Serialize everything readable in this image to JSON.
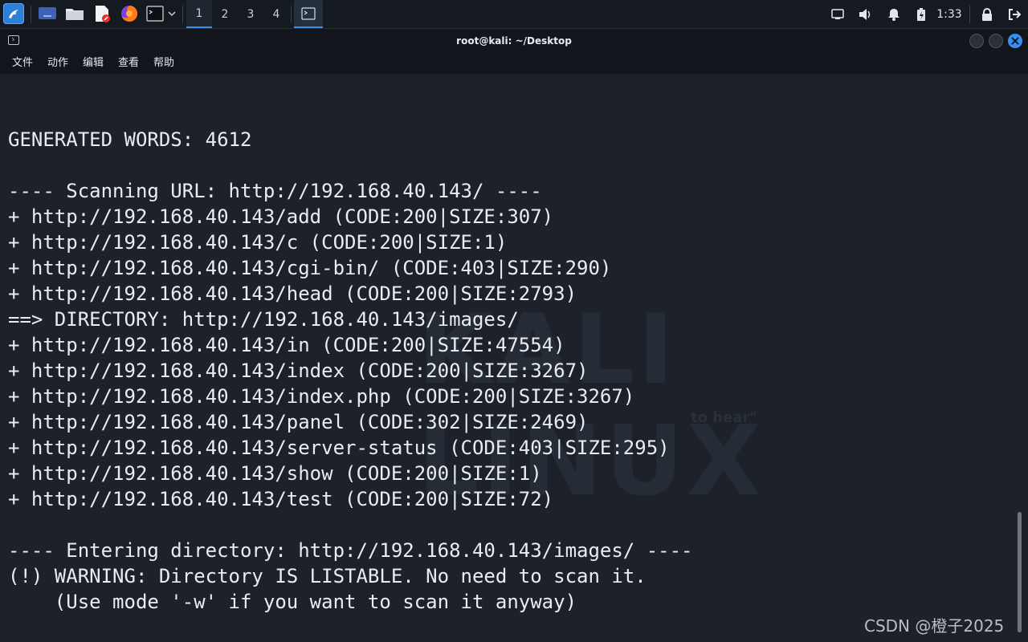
{
  "taskbar": {
    "workspaces": [
      "1",
      "2",
      "3",
      "4"
    ],
    "clock": "1:33",
    "launchers": [
      "show-desktop",
      "file-manager",
      "text-editor",
      "firefox",
      "terminal"
    ]
  },
  "window": {
    "title": "root@kali: ~/Desktop",
    "menu": [
      "文件",
      "动作",
      "编辑",
      "查看",
      "帮助"
    ]
  },
  "terminal": {
    "lines": [
      "",
      "GENERATED WORDS: 4612",
      "",
      "---- Scanning URL: http://192.168.40.143/ ----",
      "+ http://192.168.40.143/add (CODE:200|SIZE:307)",
      "+ http://192.168.40.143/c (CODE:200|SIZE:1)",
      "+ http://192.168.40.143/cgi-bin/ (CODE:403|SIZE:290)",
      "+ http://192.168.40.143/head (CODE:200|SIZE:2793)",
      "==> DIRECTORY: http://192.168.40.143/images/",
      "+ http://192.168.40.143/in (CODE:200|SIZE:47554)",
      "+ http://192.168.40.143/index (CODE:200|SIZE:3267)",
      "+ http://192.168.40.143/index.php (CODE:200|SIZE:3267)",
      "+ http://192.168.40.143/panel (CODE:302|SIZE:2469)",
      "+ http://192.168.40.143/server-status (CODE:403|SIZE:295)",
      "+ http://192.168.40.143/show (CODE:200|SIZE:1)",
      "+ http://192.168.40.143/test (CODE:200|SIZE:72)",
      "",
      "---- Entering directory: http://192.168.40.143/images/ ----",
      "(!) WARNING: Directory IS LISTABLE. No need to scan it.",
      "    (Use mode '-w' if you want to scan it anyway)"
    ]
  },
  "wallpaper": {
    "text": "KALI LINUX",
    "tagline": "to hear\""
  },
  "watermark": "CSDN @橙子2025",
  "colors": {
    "accent": "#3d8ee8",
    "terminal_bg": "#1d222a",
    "text": "#e9ecf0"
  }
}
